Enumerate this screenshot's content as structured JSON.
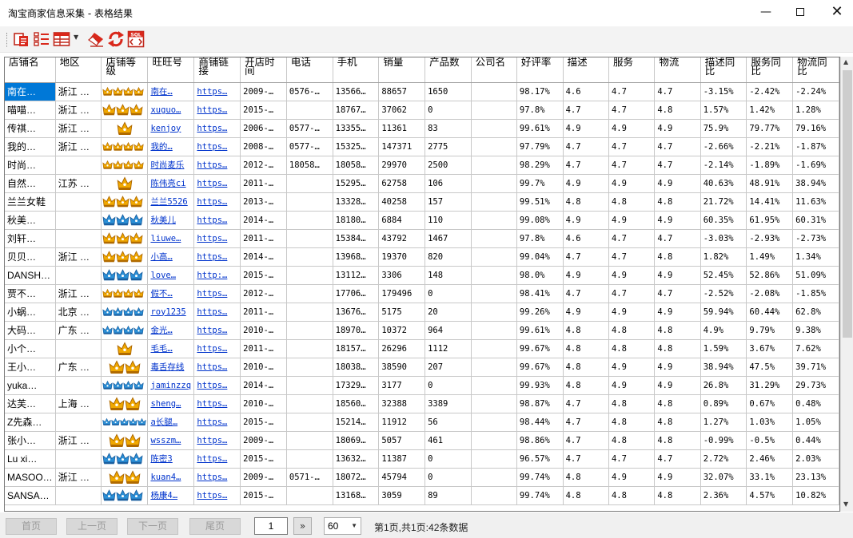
{
  "window": {
    "title": "淘宝商家信息采集 - 表格结果"
  },
  "toolbar": {
    "icons": [
      "copy-icon",
      "columns-icon",
      "layout-icon",
      "eraser-icon",
      "refresh-icon",
      "sql-export-icon"
    ],
    "sql_label": "SQL"
  },
  "table": {
    "columns": [
      "店铺名",
      "地区",
      "店铺等级",
      "旺旺号",
      "商铺链接",
      "开店时间",
      "电话",
      "手机",
      "销量",
      "产品数",
      "公司名",
      "好评率",
      "描述",
      "服务",
      "物流",
      "描述同比",
      "服务同比",
      "物流同比"
    ],
    "rows": [
      {
        "name": "南在…",
        "region": "浙江 …",
        "level": "4crown",
        "wangwang": "南在…",
        "link": "https…",
        "since": "2009-…",
        "tel": "0576-…",
        "mobile": "13566…",
        "sales": "88657",
        "products": "1650",
        "company": "",
        "rate": "98.17%",
        "desc": "4.6",
        "serv": "4.7",
        "logi": "4.7",
        "desc_cmp": "-3.15%",
        "serv_cmp": "-2.42%",
        "logi_cmp": "-2.24%"
      },
      {
        "name": "喵喵…",
        "region": "浙江 …",
        "level": "3crown",
        "wangwang": "xuguo…",
        "link": "https…",
        "since": "2015-…",
        "tel": "",
        "mobile": "18767…",
        "sales": "37062",
        "products": "0",
        "company": "",
        "rate": "97.8%",
        "desc": "4.7",
        "serv": "4.7",
        "logi": "4.8",
        "desc_cmp": "1.57%",
        "serv_cmp": "1.42%",
        "logi_cmp": "1.28%"
      },
      {
        "name": "传祺…",
        "region": "浙江 …",
        "level": "1crown",
        "wangwang": "kenjoy",
        "link": "https…",
        "since": "2006-…",
        "tel": "0577-…",
        "mobile": "13355…",
        "sales": "11361",
        "products": "83",
        "company": "",
        "rate": "99.61%",
        "desc": "4.9",
        "serv": "4.9",
        "logi": "4.9",
        "desc_cmp": "75.9%",
        "serv_cmp": "79.77%",
        "logi_cmp": "79.16%"
      },
      {
        "name": "我的…",
        "region": "浙江 …",
        "level": "4crown",
        "wangwang": "我的…",
        "link": "https…",
        "since": "2008-…",
        "tel": "0577-…",
        "mobile": "15325…",
        "sales": "147371",
        "products": "2775",
        "company": "",
        "rate": "97.79%",
        "desc": "4.7",
        "serv": "4.7",
        "logi": "4.7",
        "desc_cmp": "-2.66%",
        "serv_cmp": "-2.21%",
        "logi_cmp": "-1.87%"
      },
      {
        "name": "时尚…",
        "region": "",
        "level": "4crown",
        "wangwang": "时尚麦乐",
        "link": "https…",
        "since": "2012-…",
        "tel": "18058…",
        "mobile": "18058…",
        "sales": "29970",
        "products": "2500",
        "company": "",
        "rate": "98.29%",
        "desc": "4.7",
        "serv": "4.7",
        "logi": "4.7",
        "desc_cmp": "-2.14%",
        "serv_cmp": "-1.89%",
        "logi_cmp": "-1.69%"
      },
      {
        "name": "自然…",
        "region": "江苏 …",
        "level": "1crown",
        "wangwang": "陈伟亮ci",
        "link": "https…",
        "since": "2011-…",
        "tel": "",
        "mobile": "15295…",
        "sales": "62758",
        "products": "106",
        "company": "",
        "rate": "99.7%",
        "desc": "4.9",
        "serv": "4.9",
        "logi": "4.9",
        "desc_cmp": "40.63%",
        "serv_cmp": "48.91%",
        "logi_cmp": "38.94%"
      },
      {
        "name": "兰兰女鞋",
        "region": "",
        "level": "3crown",
        "wangwang": "兰兰5526",
        "link": "https…",
        "since": "2013-…",
        "tel": "",
        "mobile": "13328…",
        "sales": "40258",
        "products": "157",
        "company": "",
        "rate": "99.51%",
        "desc": "4.8",
        "serv": "4.8",
        "logi": "4.8",
        "desc_cmp": "21.72%",
        "serv_cmp": "14.41%",
        "logi_cmp": "11.63%"
      },
      {
        "name": "秋美…",
        "region": "",
        "level": "3blue",
        "wangwang": "秋美儿",
        "link": "https…",
        "since": "2014-…",
        "tel": "",
        "mobile": "18180…",
        "sales": "6884",
        "products": "110",
        "company": "",
        "rate": "99.08%",
        "desc": "4.9",
        "serv": "4.9",
        "logi": "4.9",
        "desc_cmp": "60.35%",
        "serv_cmp": "61.95%",
        "logi_cmp": "60.31%"
      },
      {
        "name": "刘轩…",
        "region": "",
        "level": "3crown",
        "wangwang": "liuwe…",
        "link": "https…",
        "since": "2011-…",
        "tel": "",
        "mobile": "15384…",
        "sales": "43792",
        "products": "1467",
        "company": "",
        "rate": "97.8%",
        "desc": "4.6",
        "serv": "4.7",
        "logi": "4.7",
        "desc_cmp": "-3.03%",
        "serv_cmp": "-2.93%",
        "logi_cmp": "-2.73%"
      },
      {
        "name": "贝贝…",
        "region": "浙江 …",
        "level": "3crown",
        "wangwang": "小高…",
        "link": "https…",
        "since": "2014-…",
        "tel": "",
        "mobile": "13968…",
        "sales": "19370",
        "products": "820",
        "company": "",
        "rate": "99.04%",
        "desc": "4.7",
        "serv": "4.7",
        "logi": "4.8",
        "desc_cmp": "1.82%",
        "serv_cmp": "1.49%",
        "logi_cmp": "1.34%"
      },
      {
        "name": "DANSH…",
        "region": "",
        "level": "3blue",
        "wangwang": "love…",
        "link": "http:…",
        "since": "2015-…",
        "tel": "",
        "mobile": "13112…",
        "sales": "3306",
        "products": "148",
        "company": "",
        "rate": "98.0%",
        "desc": "4.9",
        "serv": "4.9",
        "logi": "4.9",
        "desc_cmp": "52.45%",
        "serv_cmp": "52.86%",
        "logi_cmp": "51.09%"
      },
      {
        "name": "贾不…",
        "region": "浙江 …",
        "level": "4crown",
        "wangwang": "假不…",
        "link": "https…",
        "since": "2012-…",
        "tel": "",
        "mobile": "17706…",
        "sales": "179496",
        "products": "0",
        "company": "",
        "rate": "98.41%",
        "desc": "4.7",
        "serv": "4.7",
        "logi": "4.7",
        "desc_cmp": "-2.52%",
        "serv_cmp": "-2.08%",
        "logi_cmp": "-1.85%"
      },
      {
        "name": "小蜗…",
        "region": "北京 …",
        "level": "4blue",
        "wangwang": "roy1235",
        "link": "https…",
        "since": "2011-…",
        "tel": "",
        "mobile": "13676…",
        "sales": "5175",
        "products": "20",
        "company": "",
        "rate": "99.26%",
        "desc": "4.9",
        "serv": "4.9",
        "logi": "4.9",
        "desc_cmp": "59.94%",
        "serv_cmp": "60.44%",
        "logi_cmp": "62.8%"
      },
      {
        "name": "大码…",
        "region": "广东 …",
        "level": "4blue",
        "wangwang": "金光…",
        "link": "https…",
        "since": "2010-…",
        "tel": "",
        "mobile": "18970…",
        "sales": "10372",
        "products": "964",
        "company": "",
        "rate": "99.61%",
        "desc": "4.8",
        "serv": "4.8",
        "logi": "4.8",
        "desc_cmp": "4.9%",
        "serv_cmp": "9.79%",
        "logi_cmp": "9.38%"
      },
      {
        "name": "小个…",
        "region": "",
        "level": "1crown",
        "wangwang": "毛毛…",
        "link": "https…",
        "since": "2011-…",
        "tel": "",
        "mobile": "18157…",
        "sales": "26296",
        "products": "1112",
        "company": "",
        "rate": "99.67%",
        "desc": "4.8",
        "serv": "4.8",
        "logi": "4.8",
        "desc_cmp": "1.59%",
        "serv_cmp": "3.67%",
        "logi_cmp": "7.62%"
      },
      {
        "name": "王小…",
        "region": "广东 …",
        "level": "2crown",
        "wangwang": "毒舌存线",
        "link": "https…",
        "since": "2010-…",
        "tel": "",
        "mobile": "18038…",
        "sales": "38590",
        "products": "207",
        "company": "",
        "rate": "99.67%",
        "desc": "4.8",
        "serv": "4.9",
        "logi": "4.9",
        "desc_cmp": "38.94%",
        "serv_cmp": "47.5%",
        "logi_cmp": "39.71%"
      },
      {
        "name": "yuka…",
        "region": "",
        "level": "4blue",
        "wangwang": "jaminzzq",
        "link": "https…",
        "since": "2014-…",
        "tel": "",
        "mobile": "17329…",
        "sales": "3177",
        "products": "0",
        "company": "",
        "rate": "99.93%",
        "desc": "4.8",
        "serv": "4.9",
        "logi": "4.9",
        "desc_cmp": "26.8%",
        "serv_cmp": "31.29%",
        "logi_cmp": "29.73%"
      },
      {
        "name": "达芙…",
        "region": "上海 …",
        "level": "2crown",
        "wangwang": "sheng…",
        "link": "https…",
        "since": "2010-…",
        "tel": "",
        "mobile": "18560…",
        "sales": "32388",
        "products": "3389",
        "company": "",
        "rate": "98.87%",
        "desc": "4.7",
        "serv": "4.8",
        "logi": "4.8",
        "desc_cmp": "0.89%",
        "serv_cmp": "0.67%",
        "logi_cmp": "0.48%"
      },
      {
        "name": "Z先森…",
        "region": "",
        "level": "5blue",
        "wangwang": "a长腿…",
        "link": "https…",
        "since": "2015-…",
        "tel": "",
        "mobile": "15214…",
        "sales": "11912",
        "products": "56",
        "company": "",
        "rate": "98.44%",
        "desc": "4.7",
        "serv": "4.8",
        "logi": "4.8",
        "desc_cmp": "1.27%",
        "serv_cmp": "1.03%",
        "logi_cmp": "1.05%"
      },
      {
        "name": "张小…",
        "region": "浙江 …",
        "level": "2crown",
        "wangwang": "wsszm…",
        "link": "https…",
        "since": "2009-…",
        "tel": "",
        "mobile": "18069…",
        "sales": "5057",
        "products": "461",
        "company": "",
        "rate": "98.86%",
        "desc": "4.7",
        "serv": "4.8",
        "logi": "4.8",
        "desc_cmp": "-0.99%",
        "serv_cmp": "-0.5%",
        "logi_cmp": "0.44%"
      },
      {
        "name": "Lu xi…",
        "region": "",
        "level": "3blue",
        "wangwang": "陈密3",
        "link": "https…",
        "since": "2015-…",
        "tel": "",
        "mobile": "13632…",
        "sales": "11387",
        "products": "0",
        "company": "",
        "rate": "96.57%",
        "desc": "4.7",
        "serv": "4.7",
        "logi": "4.7",
        "desc_cmp": "2.72%",
        "serv_cmp": "2.46%",
        "logi_cmp": "2.03%"
      },
      {
        "name": "MASOO…",
        "region": "浙江 …",
        "level": "2crown",
        "wangwang": "kuan4…",
        "link": "https…",
        "since": "2009-…",
        "tel": "0571-…",
        "mobile": "18072…",
        "sales": "45794",
        "products": "0",
        "company": "",
        "rate": "99.74%",
        "desc": "4.8",
        "serv": "4.9",
        "logi": "4.9",
        "desc_cmp": "32.07%",
        "serv_cmp": "33.1%",
        "logi_cmp": "23.13%"
      },
      {
        "name": "SANSA…",
        "region": "",
        "level": "3blue",
        "wangwang": "杨康4…",
        "link": "https…",
        "since": "2015-…",
        "tel": "",
        "mobile": "13168…",
        "sales": "3059",
        "products": "89",
        "company": "",
        "rate": "99.74%",
        "desc": "4.8",
        "serv": "4.8",
        "logi": "4.8",
        "desc_cmp": "2.36%",
        "serv_cmp": "4.57%",
        "logi_cmp": "10.82%"
      }
    ]
  },
  "pager": {
    "first": "首页",
    "prev": "上一页",
    "next": "下一页",
    "last": "尾页",
    "page": "1",
    "go": "»",
    "page_size": "60",
    "info": "第1页,共1页:42条数据"
  },
  "colors": {
    "selection": "#0078d7",
    "link": "#0033cc",
    "crown_gold": "#f0a800",
    "crown_blue": "#2a8fd6"
  }
}
